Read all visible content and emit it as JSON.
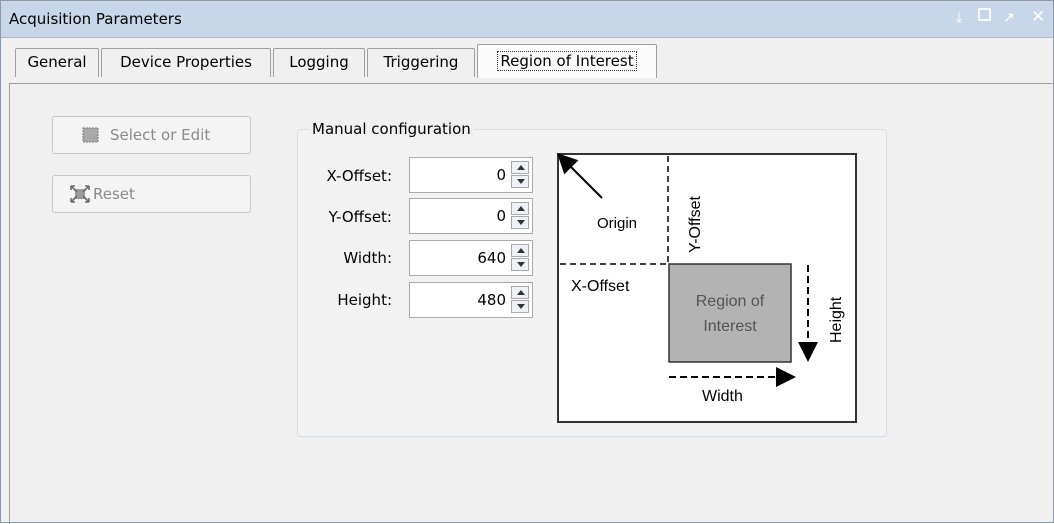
{
  "window": {
    "title": "Acquisition Parameters",
    "controls": [
      "pin-icon",
      "maximize-icon",
      "undock-icon",
      "close-icon"
    ]
  },
  "tabs": [
    {
      "label": "General",
      "active": false
    },
    {
      "label": "Device Properties",
      "active": false
    },
    {
      "label": "Logging",
      "active": false
    },
    {
      "label": "Triggering",
      "active": false
    },
    {
      "label": "Region of Interest",
      "active": true
    }
  ],
  "buttons": {
    "select_edit": {
      "label": "Select or Edit",
      "icon": "region-select-icon",
      "enabled": false
    },
    "reset": {
      "label": "Reset",
      "icon": "reset-expand-icon",
      "enabled": false
    }
  },
  "manual_config": {
    "title": "Manual configuration",
    "fields": [
      {
        "label": "X-Offset:",
        "value": "0"
      },
      {
        "label": "Y-Offset:",
        "value": "0"
      },
      {
        "label": "Width:",
        "value": "640"
      },
      {
        "label": "Height:",
        "value": "480"
      }
    ]
  },
  "diagram": {
    "origin": "Origin",
    "y_offset": "Y-Offset",
    "x_offset": "X-Offset",
    "roi_line1": "Region of",
    "roi_line2": "Interest",
    "height": "Height",
    "width": "Width"
  },
  "colors": {
    "titlebar": "#c8d6e9",
    "panel": "#f0f0f0",
    "roi_fill": "#b3b3b3",
    "disabled_text": "#8a8a8a"
  }
}
